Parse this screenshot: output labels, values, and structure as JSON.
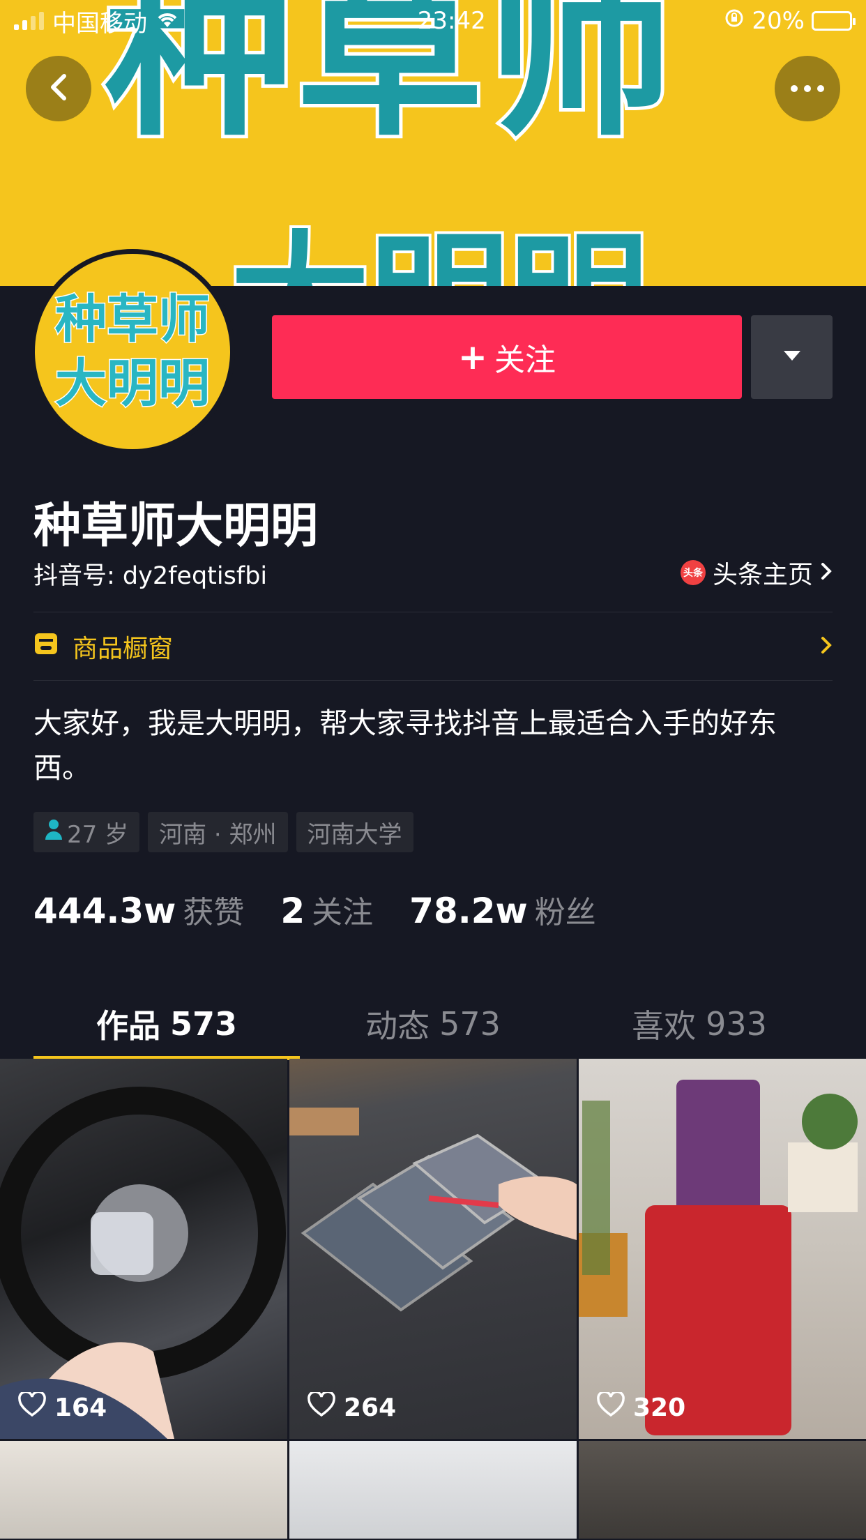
{
  "status_bar": {
    "carrier": "中国移动",
    "time": "23:42",
    "battery": "20%",
    "battery_level": 0.2
  },
  "banner": {
    "line1": "种草师",
    "line2": "大明明"
  },
  "avatar": {
    "line1": "种草师",
    "line2": "大明明"
  },
  "actions": {
    "follow_label": "关注"
  },
  "profile": {
    "name": "种草师大明明",
    "douyin_id": "抖音号: dy2feqtisfbi",
    "toutiao_icon_text": "头条",
    "toutiao_label": "头条主页"
  },
  "shop": {
    "label": "商品橱窗"
  },
  "bio": "大家好，我是大明明，帮大家寻找抖音上最适合入手的好东西。",
  "tags": [
    {
      "label": "27 岁"
    },
    {
      "label": "河南 · 郑州"
    },
    {
      "label": "河南大学"
    }
  ],
  "stats": [
    {
      "value": "444.3w",
      "label": "获赞"
    },
    {
      "value": "2",
      "label": "关注"
    },
    {
      "value": "78.2w",
      "label": "粉丝"
    }
  ],
  "tabs": [
    {
      "label": "作品",
      "count": "573"
    },
    {
      "label": "动态",
      "count": "573"
    },
    {
      "label": "喜欢",
      "count": "933"
    }
  ],
  "videos": [
    {
      "likes": "164"
    },
    {
      "likes": "264"
    },
    {
      "likes": "320"
    }
  ],
  "colors": {
    "background": "#161823",
    "accent": "#fe2c55",
    "highlight": "#f5c51d"
  }
}
